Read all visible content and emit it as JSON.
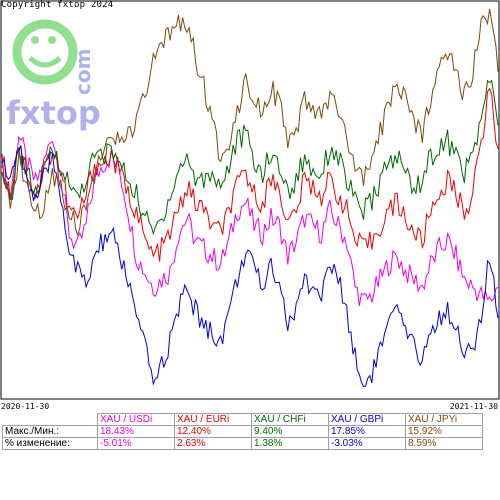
{
  "copyright": "Copyright fxtop 2024",
  "logo": {
    "domain": "com",
    "name": "fxtop",
    "colors": {
      "smiley": "#90e090",
      "text": "#b0b0ee"
    }
  },
  "table": {
    "row_labels": [
      "Макс./Мин.:",
      "% изменение:"
    ]
  },
  "chart_data": {
    "type": "line",
    "x_start": "2020-11-30",
    "x_end": "2021-11-30",
    "series": [
      {
        "name": "XAU / USDi",
        "color": "#ee00ee",
        "max_min": "18.43%",
        "change": "-5.01%",
        "values": [
          62,
          52,
          68,
          60,
          55,
          60,
          68,
          56,
          42,
          38,
          44,
          56,
          60,
          62,
          58,
          48,
          36,
          32,
          28,
          30,
          32,
          42,
          46,
          40,
          38,
          36,
          34,
          40,
          48,
          50,
          44,
          42,
          46,
          44,
          36,
          40,
          46,
          44,
          42,
          48,
          44,
          40,
          28,
          24,
          26,
          30,
          34,
          36,
          32,
          30,
          28,
          34,
          38,
          40,
          36,
          30,
          28,
          26,
          24,
          28
        ]
      },
      {
        "name": "XAU / EURi",
        "color": "#ee0000",
        "max_min": "12.40%",
        "change": "2.63%",
        "values": [
          60,
          52,
          66,
          58,
          52,
          58,
          64,
          58,
          48,
          46,
          52,
          60,
          60,
          62,
          58,
          52,
          48,
          40,
          36,
          38,
          42,
          48,
          54,
          50,
          48,
          44,
          42,
          48,
          54,
          58,
          52,
          50,
          56,
          54,
          44,
          48,
          56,
          54,
          52,
          56,
          52,
          48,
          40,
          38,
          40,
          44,
          48,
          50,
          46,
          42,
          40,
          48,
          52,
          56,
          52,
          48,
          52,
          66,
          80,
          64
        ]
      },
      {
        "name": "XAU / CHFi",
        "color": "#006600",
        "max_min": "9.40%",
        "change": "1.38%",
        "values": [
          56,
          50,
          64,
          58,
          52,
          58,
          64,
          60,
          54,
          52,
          56,
          62,
          62,
          64,
          60,
          56,
          52,
          46,
          42,
          46,
          52,
          58,
          62,
          56,
          56,
          58,
          54,
          60,
          66,
          68,
          60,
          58,
          62,
          60,
          52,
          56,
          62,
          58,
          58,
          64,
          62,
          56,
          50,
          48,
          50,
          56,
          60,
          62,
          58,
          54,
          56,
          62,
          64,
          66,
          62,
          58,
          62,
          72,
          82,
          70
        ]
      },
      {
        "name": "XAU / GBPi",
        "color": "#0000dd",
        "max_min": "17.85%",
        "change": "-3.03%",
        "values": [
          62,
          54,
          66,
          56,
          50,
          56,
          62,
          52,
          38,
          32,
          28,
          36,
          40,
          42,
          36,
          30,
          20,
          12,
          4,
          8,
          14,
          22,
          28,
          22,
          18,
          16,
          14,
          22,
          30,
          38,
          32,
          28,
          34,
          30,
          18,
          22,
          30,
          28,
          26,
          34,
          30,
          22,
          10,
          2,
          6,
          12,
          18,
          22,
          16,
          12,
          10,
          16,
          20,
          22,
          18,
          12,
          10,
          20,
          36,
          20
        ]
      },
      {
        "name": "XAU / JPYi",
        "color": "#7a4a0a",
        "max_min": "15.92%",
        "change": "8.59%",
        "values": [
          56,
          48,
          62,
          54,
          46,
          50,
          58,
          54,
          48,
          44,
          50,
          58,
          62,
          66,
          66,
          68,
          70,
          78,
          86,
          90,
          94,
          98,
          96,
          88,
          80,
          70,
          62,
          66,
          74,
          82,
          78,
          74,
          80,
          76,
          64,
          68,
          76,
          74,
          72,
          78,
          74,
          66,
          58,
          56,
          60,
          68,
          76,
          82,
          76,
          70,
          68,
          78,
          86,
          90,
          84,
          78,
          84,
          96,
          100,
          84
        ]
      }
    ]
  }
}
